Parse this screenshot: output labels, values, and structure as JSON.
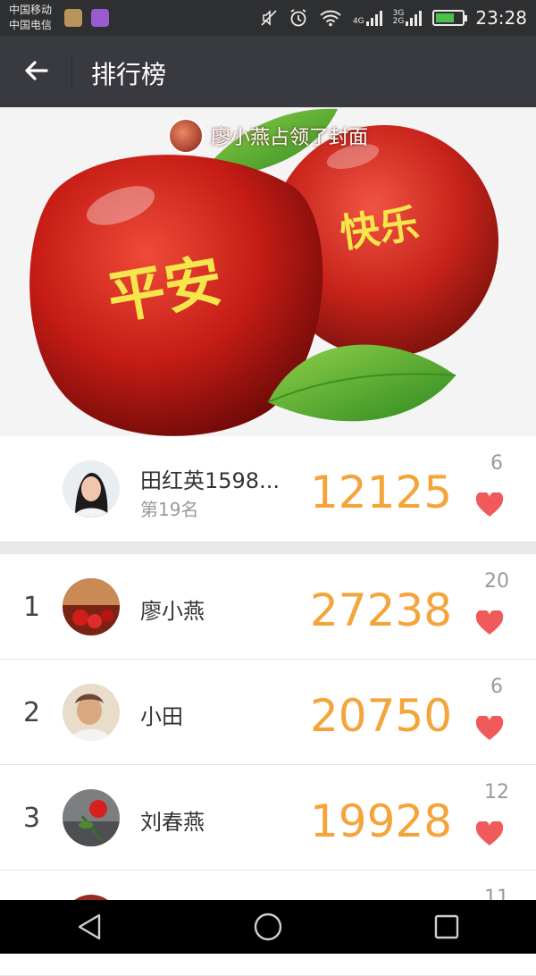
{
  "status_bar": {
    "carrier_1": "中国移动",
    "carrier_2": "中国电信",
    "network_1": "4G",
    "network_2": "3G",
    "network_3": "2G",
    "time": "23:28",
    "icons": [
      "app-icon",
      "gallery-icon",
      "mute-icon",
      "alarm-icon",
      "wifi-icon",
      "signal-icon",
      "battery-icon"
    ]
  },
  "header": {
    "title": "排行榜",
    "back_icon": "arrow-left-icon"
  },
  "cover": {
    "owner_text": "廖小燕占领了封面",
    "apple_1_text": "平安",
    "apple_2_text": "快乐"
  },
  "me": {
    "name": "田红英1598...",
    "rank_text": "第19名",
    "steps": "12125",
    "likes": "6"
  },
  "rankings": [
    {
      "rank": "1",
      "name": "廖小燕",
      "steps": "27238",
      "likes": "20"
    },
    {
      "rank": "2",
      "name": "小田",
      "steps": "20750",
      "likes": "6"
    },
    {
      "rank": "3",
      "name": "刘春燕",
      "steps": "19928",
      "likes": "12"
    },
    {
      "rank": "",
      "name": "",
      "steps": "",
      "likes": "11"
    }
  ],
  "colors": {
    "steps": "#f5a43a",
    "heart": "#f05a5a",
    "titlebar": "#393a3f"
  },
  "nav": [
    "back-icon",
    "home-icon",
    "recents-icon"
  ]
}
